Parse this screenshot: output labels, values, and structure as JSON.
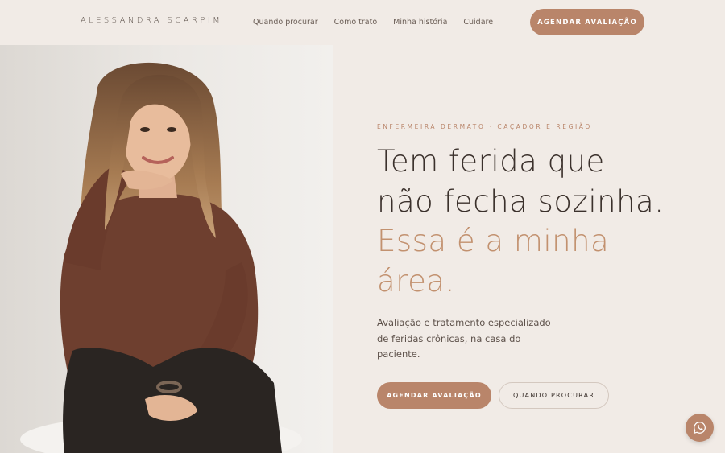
{
  "header": {
    "brand": "ALESSANDRA SCARPIM",
    "nav": [
      "Quando procurar",
      "Como trato",
      "Minha história",
      "Cuidare"
    ],
    "cta_label": "AGENDAR AVALIAÇÃO"
  },
  "hero": {
    "eyebrow": "ENFERMEIRA DERMATO · CAÇADOR E REGIÃO",
    "headline_line1": "Tem ferida que",
    "headline_line2": "não fecha sozinha.",
    "headline_accent": "Essa é a minha área.",
    "subtitle": "Avaliação e tratamento especializado de feridas crônicas, na casa do paciente.",
    "primary_button": "AGENDAR AVALIAÇÃO",
    "secondary_button": "QUANDO PROCURAR"
  },
  "icons": {
    "whatsapp": "whatsapp-icon",
    "photo": "portrait-photo"
  },
  "colors": {
    "background": "#f1ebe6",
    "accent": "#b9856a",
    "accent_text": "#c2916f",
    "text": "#3b312c"
  }
}
